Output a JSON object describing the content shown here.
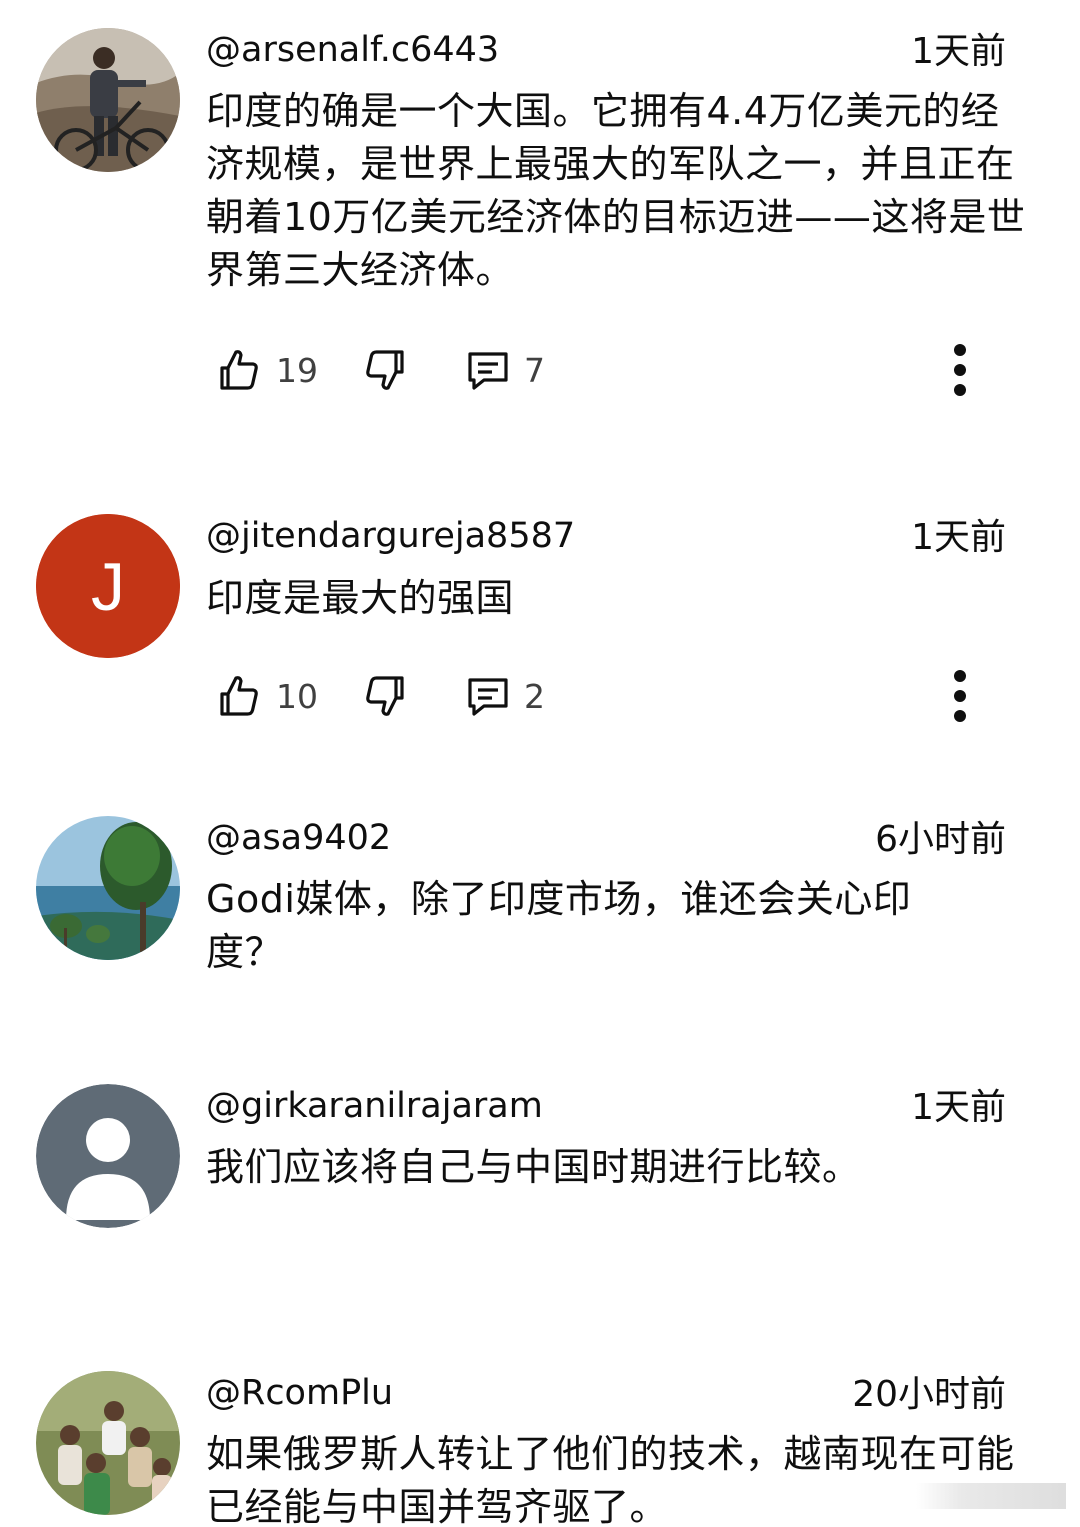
{
  "comments": [
    {
      "username": "@arsenalf.c6443",
      "timestamp": "1天前",
      "text": "印度的确是一个大国。它拥有4.4万亿美元的经济规模，是世界上最强大的军队之一，并且正在朝着10万亿美元经济体的目标迈进——这将是世界第三大经济体。",
      "likes": "19",
      "replies": "7",
      "avatar": "photo-cyclist"
    },
    {
      "username": "@jitendargureja8587",
      "timestamp": "1天前",
      "text": "印度是最大的强国",
      "likes": "10",
      "replies": "2",
      "avatar_letter": "J",
      "avatar_color": "#c33516"
    },
    {
      "username": "@asa9402",
      "timestamp": "6小时前",
      "text": "Godi媒体，除了印度市场，谁还会关心印度？",
      "avatar": "photo-palm-trees"
    },
    {
      "username": "@girkaranilrajaram",
      "timestamp": "1天前",
      "text": "我们应该将自己与中国时期进行比较。",
      "avatar": "default-person-icon",
      "avatar_color": "#5f6b76"
    },
    {
      "username": "@RcomPlu",
      "timestamp": "20小时前",
      "text": "如果俄罗斯人转让了他们的技术，越南现在可能已经能与中国并驾齐驱了。",
      "avatar": "photo-group"
    }
  ],
  "icons": {
    "like": "thumbs-up-icon",
    "dislike": "thumbs-down-icon",
    "reply": "comment-icon",
    "more": "more-vertical-icon"
  }
}
